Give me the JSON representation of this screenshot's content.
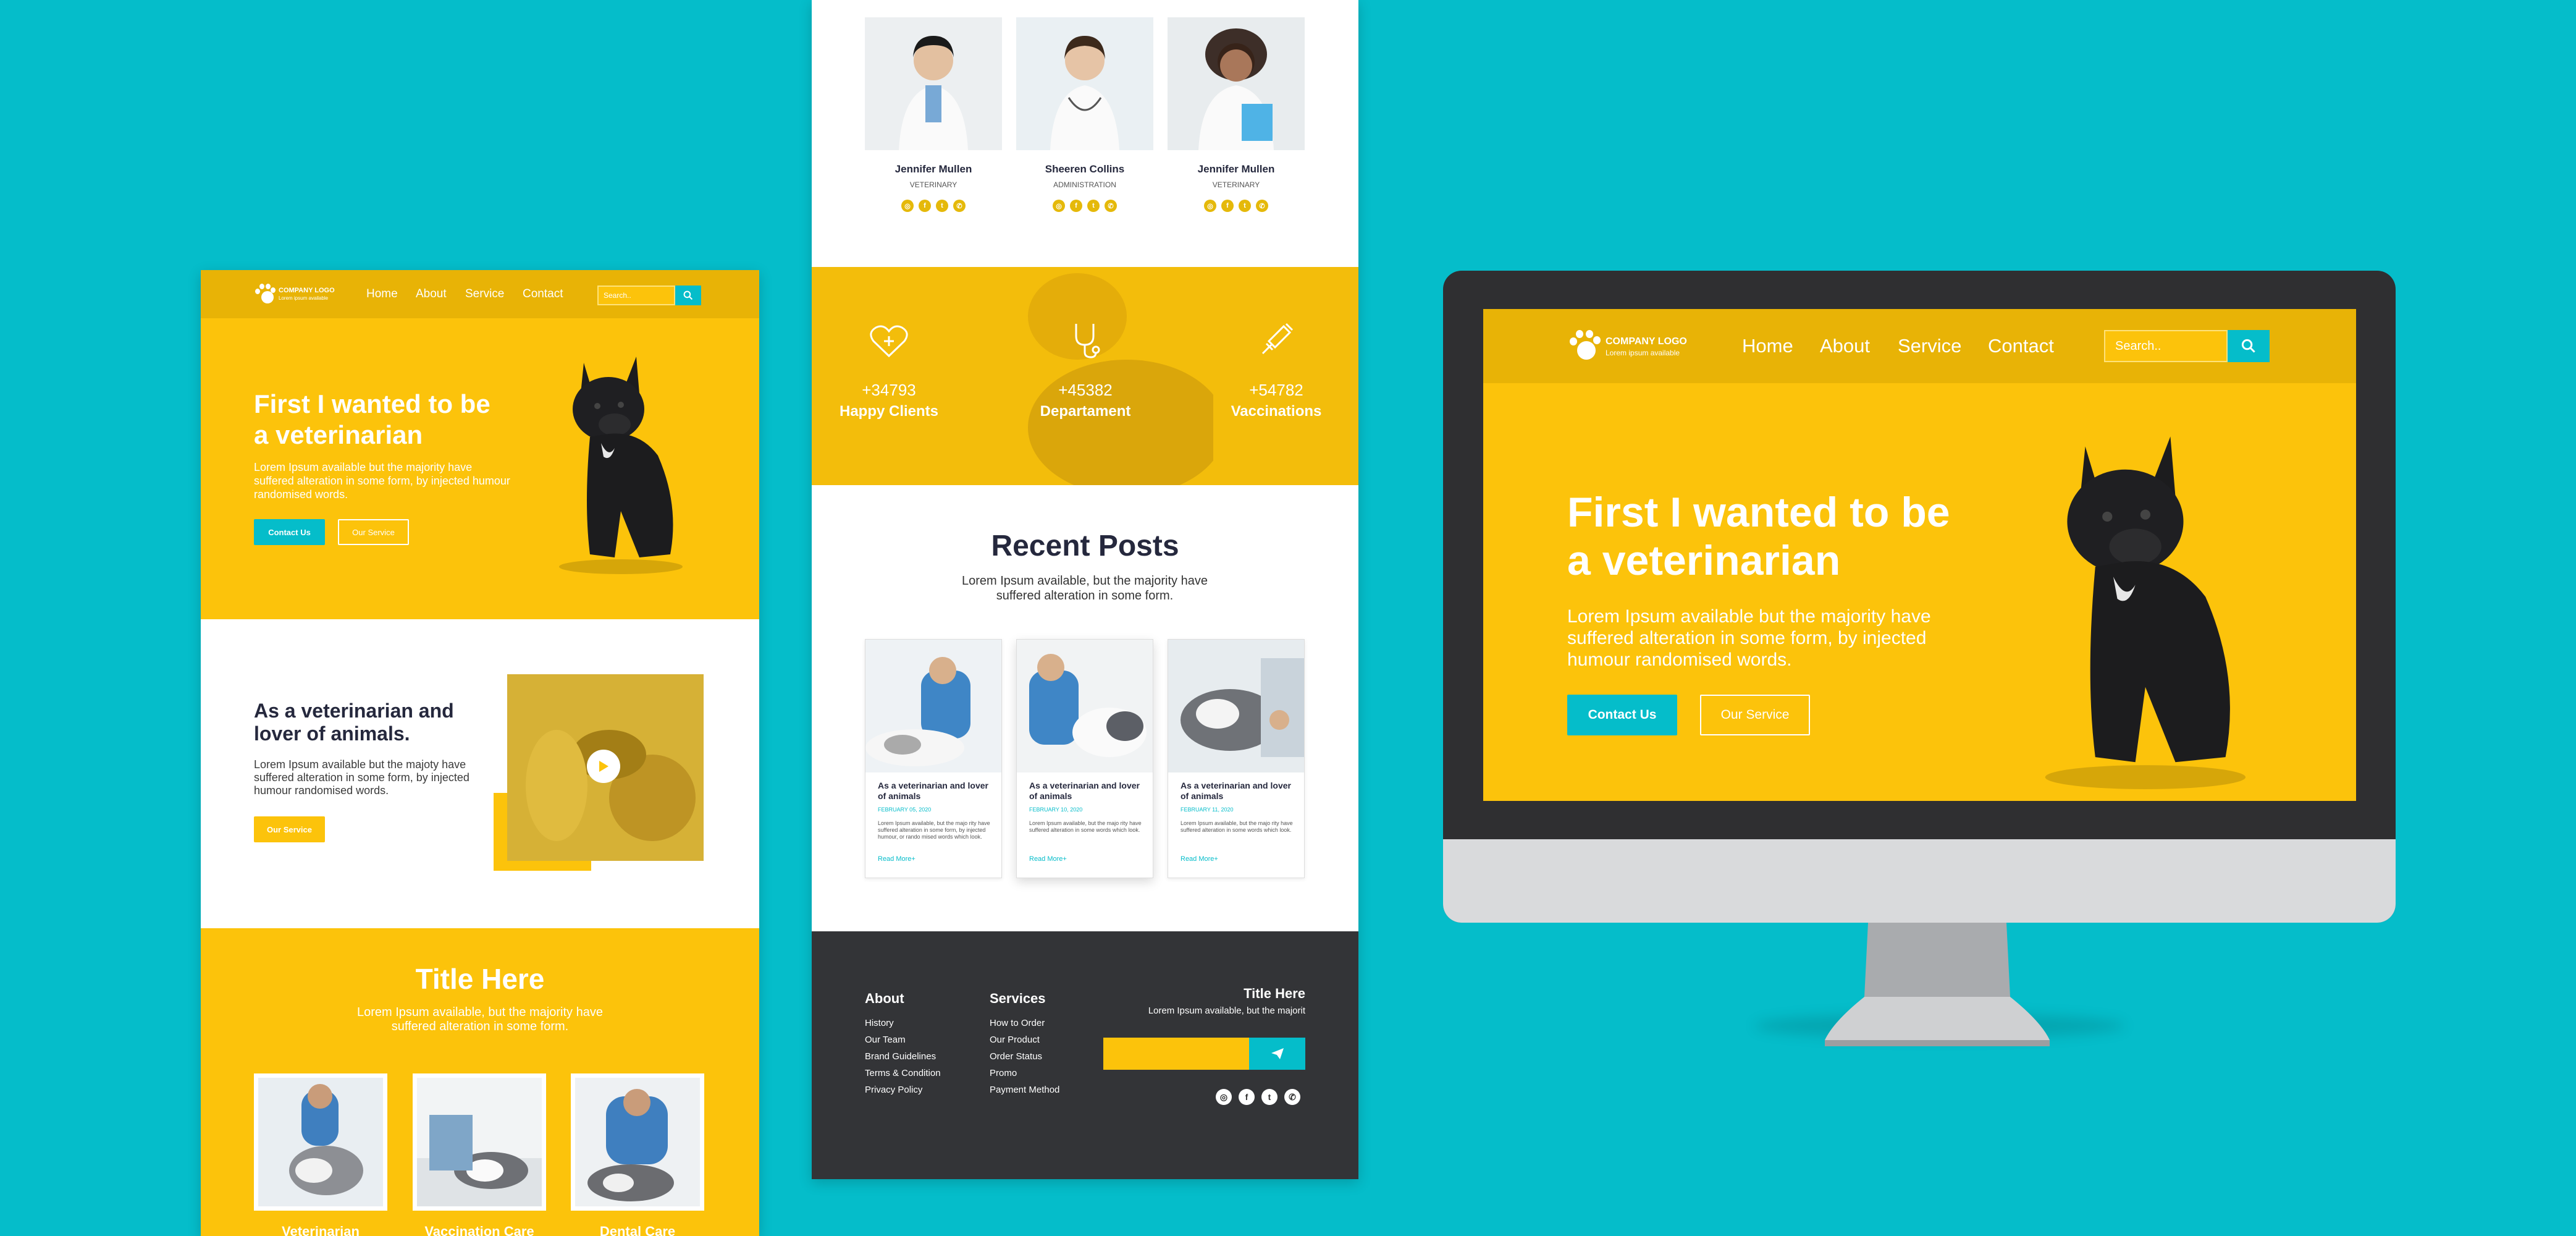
{
  "brand": {
    "logo_text": "COMPANY LOGO",
    "logo_sub": "Lorem ipsum available",
    "yellow": "#fcc30b",
    "teal": "#05bdca",
    "dark": "#25283d"
  },
  "nav": {
    "items": [
      "Home",
      "About",
      "Service",
      "Contact"
    ],
    "search_placeholder": "Search..",
    "search_icon": "search-icon"
  },
  "hero": {
    "title_line1": "First I wanted to be",
    "title_line2": "a veterinarian",
    "body": "Lorem Ipsum available but the majority have suffered alteration in some form, by injected humour randomised words.",
    "contact_btn": "Contact Us",
    "service_btn": "Our Service"
  },
  "about": {
    "title_line1": "As a veterinarian and",
    "title_line2": "lover of animals.",
    "body": "Lorem Ipsum available but the majoty have suffered alteration in some form, by injected humour randomised words.",
    "button": "Our Service",
    "video_icon": "play-icon"
  },
  "services_section": {
    "title": "Title Here",
    "body": "Lorem Ipsum available, but the majority have suffered alteration in some form.",
    "cards": [
      "Veterinarian",
      "Vaccination Care",
      "Dental Care"
    ]
  },
  "team": [
    {
      "name": "Jennifer Mullen",
      "role": "VETERINARY"
    },
    {
      "name": "Sheeren Collins",
      "role": "ADMINISTRATION"
    },
    {
      "name": "Jennifer Mullen",
      "role": "VETERINARY"
    }
  ],
  "social_icons": [
    "instagram-icon",
    "facebook-icon",
    "twitter-icon",
    "whatsapp-icon"
  ],
  "social_glyphs": [
    "◎",
    "f",
    "t",
    "✆"
  ],
  "stats": [
    {
      "value": "+34793",
      "label": "Happy Clients",
      "icon": "heart-plus-icon"
    },
    {
      "value": "+45382",
      "label": "Departament",
      "icon": "stethoscope-icon"
    },
    {
      "value": "+54782",
      "label": "Vaccinations",
      "icon": "syringe-icon"
    }
  ],
  "recent_posts": {
    "title": "Recent Posts",
    "body": "Lorem Ipsum available, but the majority have suffered alteration in some form.",
    "posts": [
      {
        "title": "As a veterinarian and lover of animals",
        "date": "FEBRUARY 05, 2020",
        "body": "Lorem Ipsum available, but the majo rity have suffered alteration in some form, by injected humour, or rando mised words which look.",
        "more": "Read More+"
      },
      {
        "title": "As a veterinarian and lover of animals",
        "date": "FEBRUARY 10, 2020",
        "body": "Lorem Ipsum available, but the majo rity have suffered alteration in some words which look.",
        "more": "Read More+"
      },
      {
        "title": "As a veterinarian and lover of animals",
        "date": "FEBRUARY 11, 2020",
        "body": "Lorem Ipsum available, but the majo rity have suffered alteration in some words which look.",
        "more": "Read More+"
      }
    ]
  },
  "footer": {
    "about_head": "About",
    "about_items": [
      "History",
      "Our Team",
      "Brand Guidelines",
      "Terms & Condition",
      "Privacy Policy"
    ],
    "services_head": "Services",
    "services_items": [
      "How to Order",
      "Our Product",
      "Order Status",
      "Promo",
      "Payment Method"
    ],
    "newsletter_head": "Title Here",
    "newsletter_body": "Lorem Ipsum available, but the majorit",
    "send_icon": "send-icon"
  }
}
